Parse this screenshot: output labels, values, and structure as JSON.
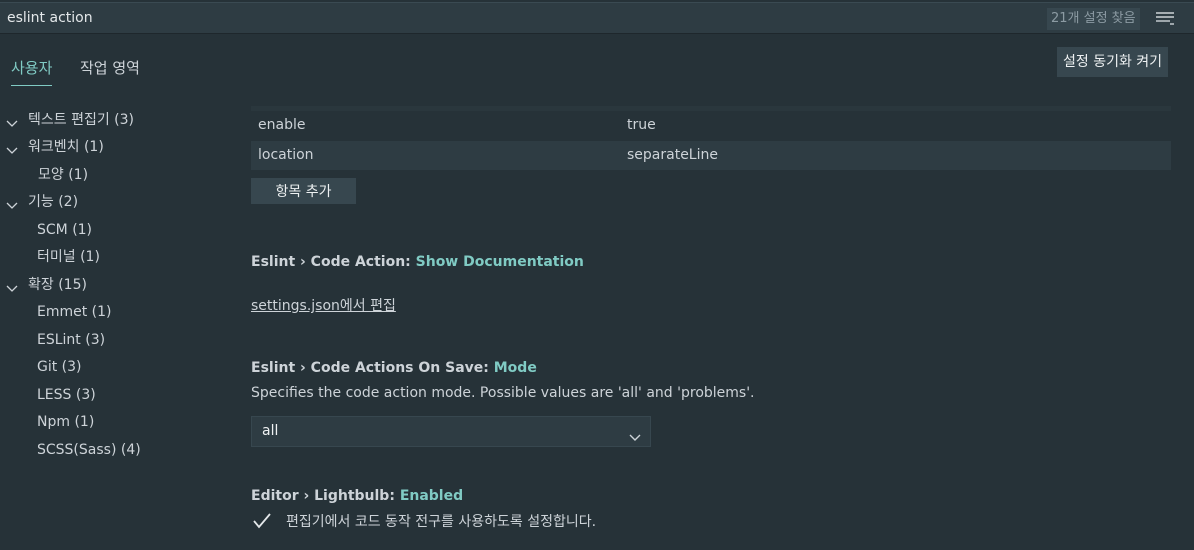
{
  "search": {
    "value": "eslint action",
    "result_count": "21개 설정 찾음"
  },
  "tabs": {
    "user": "사용자",
    "workspace": "작업 영역"
  },
  "sync_button": "설정 동기화 켜기",
  "toc": [
    {
      "label": "텍스트 편집기 (3)",
      "expanded": true
    },
    {
      "label": "워크벤치 (1)",
      "expanded": true
    },
    {
      "label": "모양 (1)"
    },
    {
      "label": "기능 (2)",
      "expanded": true
    },
    {
      "label": "SCM (1)"
    },
    {
      "label": "터미널 (1)"
    },
    {
      "label": "확장 (15)",
      "expanded": true
    },
    {
      "label": "Emmet (1)"
    },
    {
      "label": "ESLint (3)"
    },
    {
      "label": "Git (3)"
    },
    {
      "label": "LESS (3)"
    },
    {
      "label": "Npm (1)"
    },
    {
      "label": "SCSS(Sass) (4)"
    }
  ],
  "object_table": {
    "rows": [
      {
        "key": "enable",
        "value": "true"
      },
      {
        "key": "location",
        "value": "separateLine"
      }
    ],
    "add_item": "항목 추가"
  },
  "settings": {
    "show_documentation": {
      "category": "Eslint › Code Action: ",
      "name": "Show Documentation",
      "link": "settings.json에서 편집"
    },
    "mode": {
      "category": "Eslint › Code Actions On Save: ",
      "name": "Mode",
      "description": "Specifies the code action mode. Possible values are 'all' and 'problems'.",
      "selected": "all"
    },
    "lightbulb": {
      "category": "Editor › Lightbulb: ",
      "name": "Enabled",
      "checkbox_label": "편집기에서 코드 동작 전구를 사용하도록 설정합니다.",
      "checked": true
    }
  },
  "colors": {
    "background": "#263238",
    "accent": "#80cbc4",
    "control": "#37474f"
  }
}
